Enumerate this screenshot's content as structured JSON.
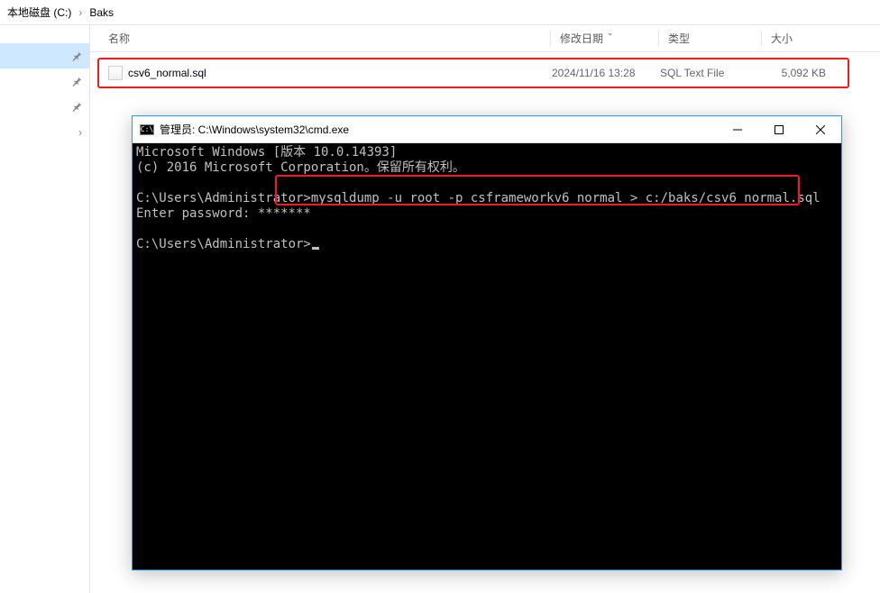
{
  "breadcrumb": {
    "item1": "本地磁盘 (C:)",
    "item2": "Baks"
  },
  "columns": {
    "name": "名称",
    "date": "修改日期",
    "type": "类型",
    "size": "大小"
  },
  "file": {
    "name": "csv6_normal.sql",
    "date": "2024/11/16 13:28",
    "type": "SQL Text File",
    "size": "5,092 KB"
  },
  "cmd": {
    "title_prefix": "管理员: ",
    "title_path": "C:\\Windows\\system32\\cmd.exe",
    "line1": "Microsoft Windows [版本 10.0.14393]",
    "line2": "(c) 2016 Microsoft Corporation。保留所有权利。",
    "prompt1": "C:\\Users\\Administrator>",
    "command": "mysqldump -u root -p csframeworkv6_normal > c:/baks/csv6_normal.sql",
    "enter_pw": "Enter password: ",
    "masked_pw": "*******",
    "prompt2": "C:\\Users\\Administrator>"
  }
}
